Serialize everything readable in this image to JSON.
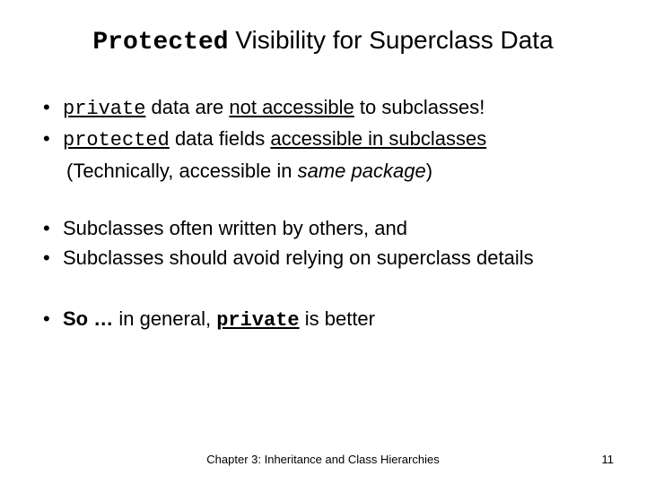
{
  "title": {
    "code": "Protected",
    "rest": " Visibility for Superclass Data"
  },
  "bullets": {
    "b1": {
      "code": "private",
      "mid": " data are ",
      "u": "not accessible",
      "tail": " to subclasses!"
    },
    "b2": {
      "code": "protected",
      "mid": " data fields ",
      "u": "accessible in subclasses"
    },
    "sub": {
      "pre": "(Technically, accessible in ",
      "it": "same package",
      "post": ")"
    },
    "b3": "Subclasses often written by others, and",
    "b4": "Subclasses should avoid relying on superclass details",
    "b5": {
      "lead": "So …",
      "mid": " in general, ",
      "code": "private",
      "tail": " is better"
    }
  },
  "footer": {
    "center": "Chapter 3: Inheritance and Class Hierarchies",
    "page": "11"
  }
}
